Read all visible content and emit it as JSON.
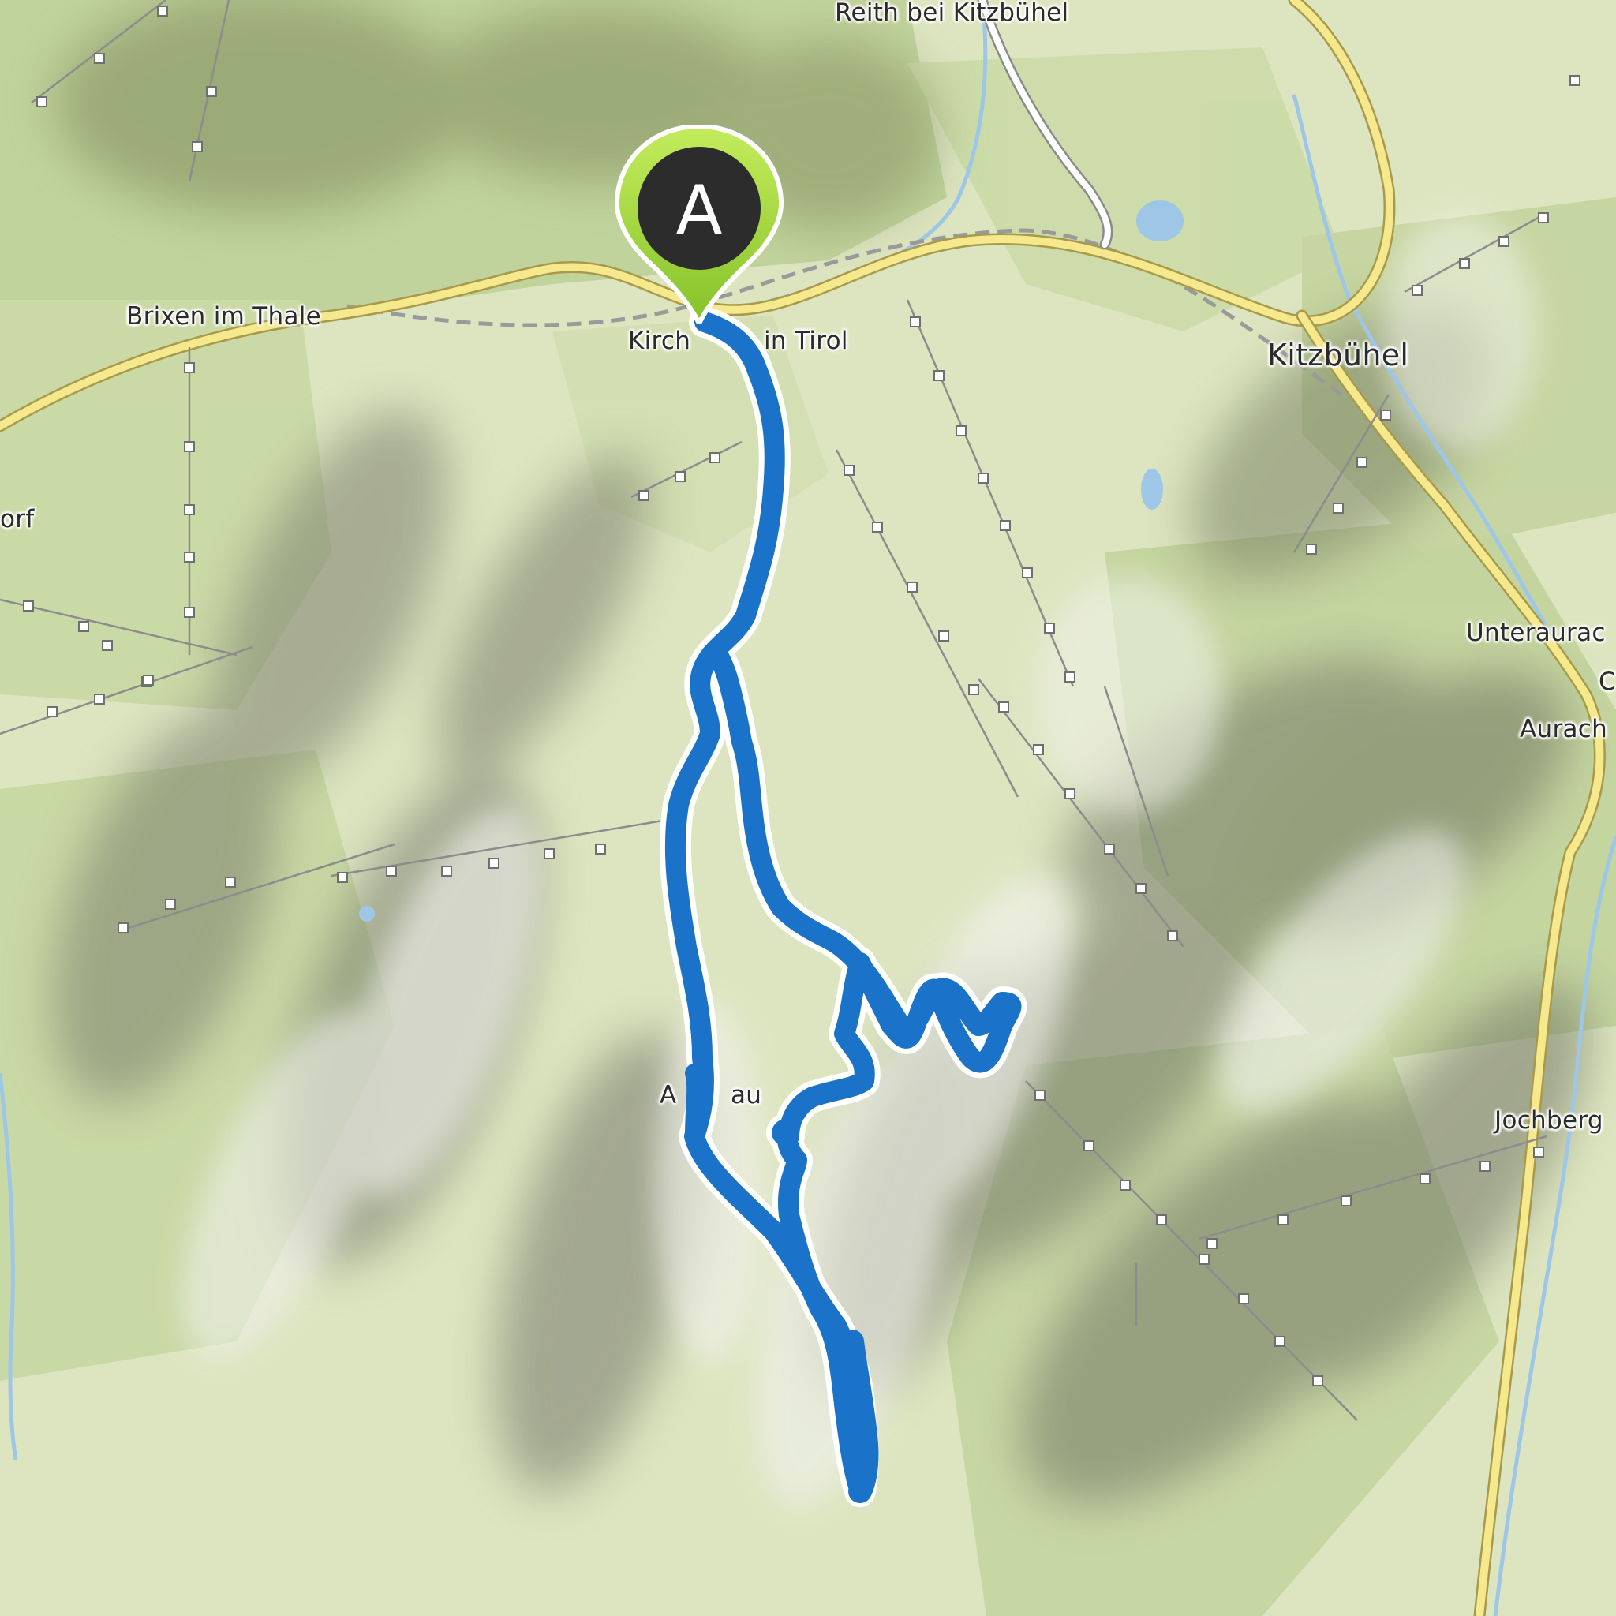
{
  "map": {
    "type": "topographic-route-map",
    "route_color": "#1a73c8",
    "route_casing_color": "#ffffff",
    "road_color": "#f3e58a",
    "lift_line_color": "#8c8c8c"
  },
  "labels": {
    "reith": "Reith bei Kitzbühel",
    "brixen": "Brixen im Thale",
    "kirchberg_left": "Kirch",
    "kirchberg_right": "in Tirol",
    "kitzbuehel": "Kitzbühel",
    "orf": "orf",
    "unteraurach": "Unteraurac",
    "c_fragment": "C",
    "aurach": "Aurach",
    "aschau_left": "A",
    "aschau_right": "au",
    "jochberg": "Jochberg"
  },
  "marker": {
    "letter": "A",
    "icon": "map-pin-icon",
    "pin_color": "#9bd135",
    "badge_color": "#2c2c2c"
  }
}
